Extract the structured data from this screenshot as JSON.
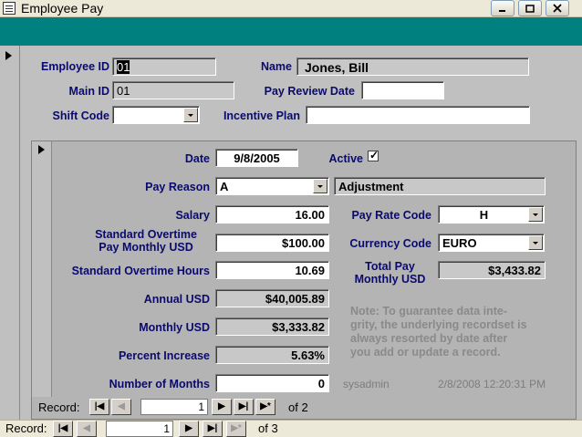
{
  "window": {
    "title": "Employee Pay"
  },
  "main": {
    "employee_id": {
      "label": "Employee ID",
      "value": "01"
    },
    "name": {
      "label": "Name",
      "value": "Jones, Bill"
    },
    "main_id": {
      "label": "Main ID",
      "value": "01"
    },
    "pay_review_date": {
      "label": "Pay Review Date",
      "value": ""
    },
    "shift_code": {
      "label": "Shift Code",
      "value": ""
    },
    "incentive_plan": {
      "label": "Incentive Plan",
      "value": ""
    }
  },
  "subform": {
    "date": {
      "label": "Date",
      "value": "9/8/2005"
    },
    "active": {
      "label": "Active",
      "checked": true,
      "check_glyph": "✓"
    },
    "pay_reason": {
      "label": "Pay Reason",
      "value": "A",
      "description": "Adjustment"
    },
    "salary": {
      "label": "Salary",
      "value": "16.00"
    },
    "pay_rate_code": {
      "label": "Pay Rate Code",
      "value": "H"
    },
    "std_ot_pay": {
      "label_line1": "Standard Overtime",
      "label_line2": "Pay Monthly USD",
      "value": "$100.00"
    },
    "currency_code": {
      "label": "Currency Code",
      "value": "EURO"
    },
    "std_ot_hours": {
      "label": "Standard Overtime Hours",
      "value": "10.69"
    },
    "total_pay": {
      "label_line1": "Total Pay",
      "label_line2": "Monthly USD",
      "value": "$3,433.82"
    },
    "annual_usd": {
      "label": "Annual USD",
      "value": "$40,005.89"
    },
    "monthly_usd": {
      "label": "Monthly USD",
      "value": "$3,333.82"
    },
    "percent_increase": {
      "label": "Percent Increase",
      "value": "5.63%"
    },
    "number_of_months": {
      "label": "Number of Months",
      "value": "0"
    },
    "note": {
      "line1": "Note: To guarantee data inte-",
      "line2": "grity, the underlying recordset is",
      "line3": "always resorted by date after",
      "line4": "you add or update a record."
    },
    "user": "sysadmin",
    "timestamp": "2/8/2008 12:20:31 PM",
    "nav": {
      "label": "Record:",
      "current": "1",
      "of_text": "of 2"
    }
  },
  "main_nav": {
    "label": "Record:",
    "current": "1",
    "of_text": "of 3"
  }
}
